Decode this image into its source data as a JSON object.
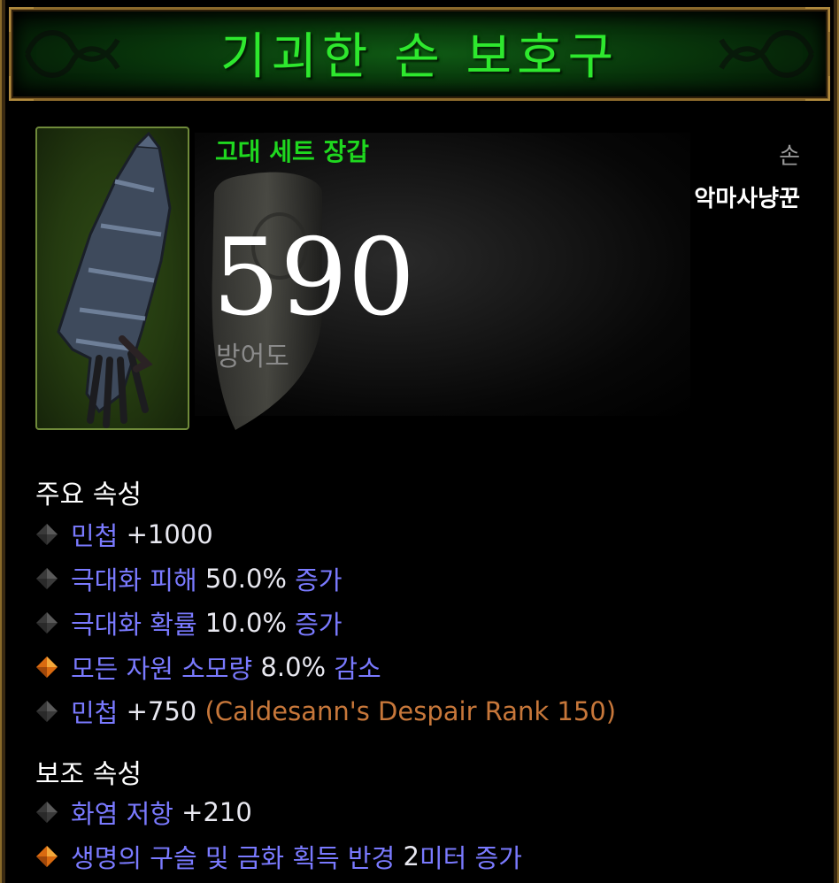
{
  "item": {
    "name": "기괴한 손 보호구",
    "type": "고대 세트 장갑",
    "slot": "손",
    "class": "악마사냥꾼",
    "armor_value": "590",
    "armor_label": "방어도"
  },
  "primary": {
    "title": "주요 속성",
    "stats": [
      {
        "bullet": "gray-diamond-icon",
        "name": "민첩",
        "value": "+1000",
        "suffix": ""
      },
      {
        "bullet": "gray-diamond-icon",
        "name": "극대화 피해",
        "value": "50.0%",
        "suffix": "증가"
      },
      {
        "bullet": "gray-diamond-icon",
        "name": "극대화 확률",
        "value": "10.0%",
        "suffix": "증가"
      },
      {
        "bullet": "orange-diamond-icon",
        "name": "모든 자원 소모량",
        "value": "8.0%",
        "suffix": "감소"
      },
      {
        "bullet": "gray-diamond-icon",
        "name": "민첩",
        "value": "+750",
        "suffix": "",
        "extra": "(Caldesann's Despair Rank 150)"
      }
    ]
  },
  "secondary": {
    "title": "보조 속성",
    "stats": [
      {
        "bullet": "gray-diamond-icon",
        "name": "화염 저항",
        "value": "+210",
        "suffix": ""
      },
      {
        "bullet": "orange-diamond-icon",
        "name": "생명의 구슬 및 금화 획득 반경",
        "value": "2",
        "suffix": "미터 증가"
      }
    ]
  },
  "colors": {
    "title_green": "#2ee82e",
    "type_green": "#1fd81f",
    "affix_blue": "#7a7aff",
    "gem_orange": "#c7773a",
    "legendary_orange": "#e8891e"
  }
}
